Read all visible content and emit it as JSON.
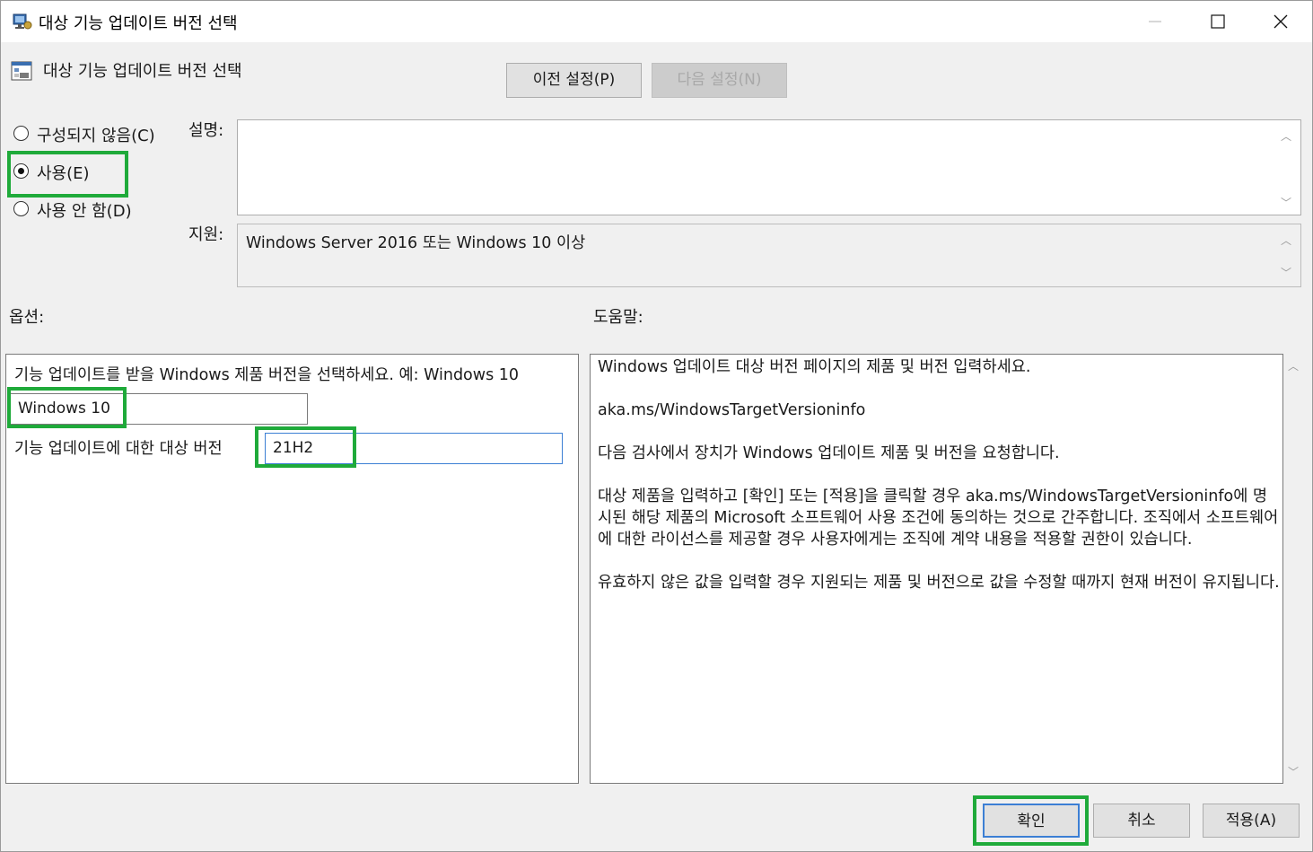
{
  "window": {
    "title": "대상 기능 업데이트 버전 선택"
  },
  "header": {
    "policy_name": "대상 기능 업데이트 버전 선택",
    "prev_button": "이전 설정(P)",
    "next_button": "다음 설정(N)"
  },
  "state": {
    "options": [
      {
        "label": "구성되지 않음(C)",
        "selected": false
      },
      {
        "label": "사용(E)",
        "selected": true
      },
      {
        "label": "사용 안 함(D)",
        "selected": false
      }
    ]
  },
  "comment": {
    "label": "설명:",
    "value": ""
  },
  "supported": {
    "label": "지원:",
    "value": "Windows Server 2016 또는 Windows 10 이상"
  },
  "options_panel": {
    "label": "옵션:",
    "product_prompt": "기능 업데이트를 받을 Windows 제품 버전을 선택하세요. 예: Windows 10",
    "product_value": "Windows 10",
    "target_label": "기능 업데이트에 대한 대상 버전",
    "target_value": "21H2"
  },
  "help_panel": {
    "label": "도움말:",
    "paragraphs": [
      "Windows 업데이트 대상 버전 페이지의 제품 및 버전 입력하세요.",
      "aka.ms/WindowsTargetVersioninfo",
      "다음 검사에서 장치가 Windows 업데이트 제품 및 버전을 요청합니다.",
      "대상 제품을 입력하고 [확인] 또는 [적용]을 클릭할 경우 aka.ms/WindowsTargetVersioninfo에 명시된 해당 제품의 Microsoft 소프트웨어 사용 조건에 동의하는 것으로 간주합니다. 조직에서 소프트웨어에 대한 라이선스를 제공할 경우 사용자에게는 조직에 계약 내용을 적용할 권한이 있습니다.",
      "유효하지 않은 값을 입력할 경우 지원되는 제품 및 버전으로 값을 수정할 때까지 현재 버전이 유지됩니다."
    ]
  },
  "footer": {
    "ok_button": "확인",
    "cancel_button": "취소",
    "apply_button": "적용(A)"
  },
  "colors": {
    "highlight": "#1faa3a",
    "focus_border": "#3c7fd4"
  }
}
